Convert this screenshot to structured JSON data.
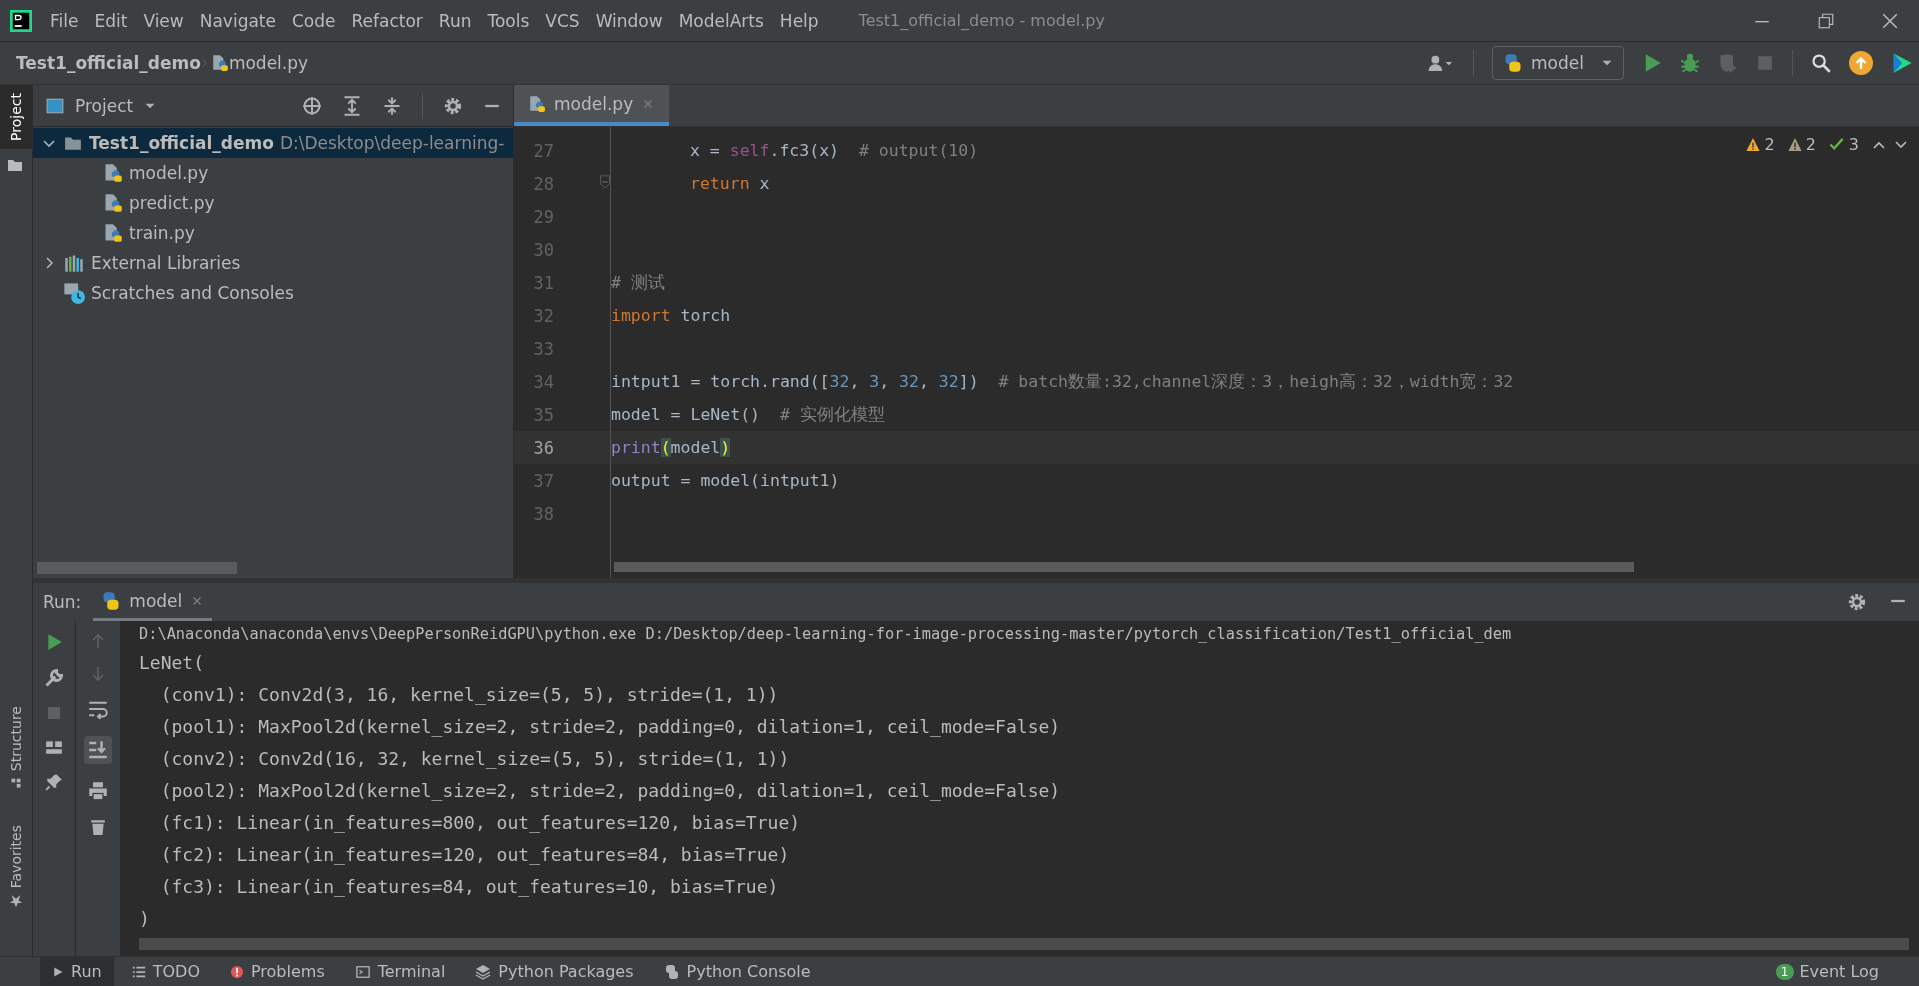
{
  "title_bar": {
    "menus": [
      "File",
      "Edit",
      "View",
      "Navigate",
      "Code",
      "Refactor",
      "Run",
      "Tools",
      "VCS",
      "Window",
      "ModelArts",
      "Help"
    ],
    "title": "Test1_official_demo - model.py"
  },
  "nav_bar": {
    "breadcrumb": [
      "Test1_official_demo",
      "model.py"
    ],
    "run_config": "model"
  },
  "left_stripe": {
    "top": [
      {
        "label": "Project",
        "selected": true
      }
    ],
    "bottom": [
      {
        "label": "Structure",
        "selected": false
      },
      {
        "label": "Favorites",
        "selected": false
      }
    ]
  },
  "project_panel": {
    "title": "Project",
    "tree": [
      {
        "label": "Test1_official_demo",
        "path": "D:\\Desktop\\deep-learning-",
        "kind": "folder",
        "expanded": true,
        "selected": true,
        "children": [
          {
            "label": "model.py",
            "kind": "python",
            "selected": false
          },
          {
            "label": "predict.py",
            "kind": "python",
            "selected": false
          },
          {
            "label": "train.py",
            "kind": "python",
            "selected": false
          }
        ]
      },
      {
        "label": "External Libraries",
        "kind": "libraries",
        "expanded": false,
        "selected": false
      },
      {
        "label": "Scratches and Consoles",
        "kind": "scratches",
        "selected": false
      }
    ]
  },
  "editor": {
    "tabs": [
      {
        "label": "model.py",
        "selected": true
      }
    ],
    "inspections": [
      {
        "kind": "warning",
        "count": "2"
      },
      {
        "kind": "weak",
        "count": "2"
      },
      {
        "kind": "typo",
        "count": "3"
      }
    ],
    "lines": [
      {
        "number": "27",
        "kind": "nested",
        "current": false,
        "tokens": [
          {
            "text": "x = ",
            "kind": "plain"
          },
          {
            "text": "self",
            "kind": "self"
          },
          {
            "text": ".fc3(x)  ",
            "kind": "plain"
          },
          {
            "text": "# output(10)",
            "kind": "comment"
          }
        ]
      },
      {
        "number": "28",
        "kind": "nested",
        "current": false,
        "tokens": [
          {
            "text": "return",
            "kind": "keyword"
          },
          {
            "text": " x",
            "kind": "plain"
          }
        ]
      },
      {
        "number": "29",
        "current": false
      },
      {
        "number": "30",
        "current": false
      },
      {
        "number": "31",
        "kind": "top",
        "current": false,
        "tokens": [
          {
            "text": "# 测试",
            "kind": "comment"
          }
        ]
      },
      {
        "number": "32",
        "kind": "top",
        "current": false,
        "tokens": [
          {
            "text": "import",
            "kind": "keyword"
          },
          {
            "text": " torch",
            "kind": "plain"
          }
        ]
      },
      {
        "number": "33",
        "current": false
      },
      {
        "number": "34",
        "kind": "top",
        "current": false,
        "tokens": [
          {
            "text": "intput1 = torch.rand([",
            "kind": "plain"
          },
          {
            "text": "32",
            "kind": "number"
          },
          {
            "text": ", ",
            "kind": "plain"
          },
          {
            "text": "3",
            "kind": "number"
          },
          {
            "text": ", ",
            "kind": "plain"
          },
          {
            "text": "32",
            "kind": "number"
          },
          {
            "text": ", ",
            "kind": "plain"
          },
          {
            "text": "32",
            "kind": "number"
          },
          {
            "text": "])  ",
            "kind": "plain"
          },
          {
            "text": "# batch数量:32,channel深度：3，heigh高：32，width宽：32",
            "kind": "comment"
          }
        ]
      },
      {
        "number": "35",
        "kind": "top",
        "current": false,
        "tokens": [
          {
            "text": "model = LeNet()  ",
            "kind": "plain"
          },
          {
            "text": "# 实例化模型",
            "kind": "comment"
          }
        ]
      },
      {
        "number": "36",
        "kind": "top",
        "current": true,
        "tokens": [
          {
            "text": "print",
            "kind": "builtin"
          },
          {
            "text": "(",
            "kind": "brace"
          },
          {
            "text": "model",
            "kind": "plain"
          },
          {
            "text": ")",
            "kind": "brace"
          }
        ]
      },
      {
        "number": "37",
        "kind": "top",
        "current": false,
        "tokens": [
          {
            "text": "output = model(intput1)",
            "kind": "plain"
          }
        ]
      },
      {
        "number": "38",
        "current": false
      }
    ]
  },
  "run_panel": {
    "label": "Run:",
    "tabs": [
      {
        "label": "model",
        "selected": true
      }
    ],
    "output": [
      "D:\\Anaconda\\anaconda\\envs\\DeepPersonReidGPU\\python.exe D:/Desktop/deep-learning-for-image-processing-master/pytorch_classification/Test1_official_dem",
      "LeNet(",
      "  (conv1): Conv2d(3, 16, kernel_size=(5, 5), stride=(1, 1))",
      "  (pool1): MaxPool2d(kernel_size=2, stride=2, padding=0, dilation=1, ceil_mode=False)",
      "  (conv2): Conv2d(16, 32, kernel_size=(5, 5), stride=(1, 1))",
      "  (pool2): MaxPool2d(kernel_size=2, stride=2, padding=0, dilation=1, ceil_mode=False)",
      "  (fc1): Linear(in_features=800, out_features=120, bias=True)",
      "  (fc2): Linear(in_features=120, out_features=84, bias=True)",
      "  (fc3): Linear(in_features=84, out_features=10, bias=True)",
      ")"
    ]
  },
  "bottom_bar": {
    "tabs": [
      {
        "label": "Run",
        "kind": "run",
        "selected": true
      },
      {
        "label": "TODO",
        "kind": "todo",
        "selected": false
      },
      {
        "label": "Problems",
        "kind": "problems",
        "selected": false
      },
      {
        "label": "Terminal",
        "kind": "terminal",
        "selected": false
      },
      {
        "label": "Python Packages",
        "kind": "packages",
        "selected": false
      },
      {
        "label": "Python Console",
        "kind": "console",
        "selected": false
      }
    ],
    "event_log": {
      "label": "Event Log",
      "badge": "1"
    }
  }
}
